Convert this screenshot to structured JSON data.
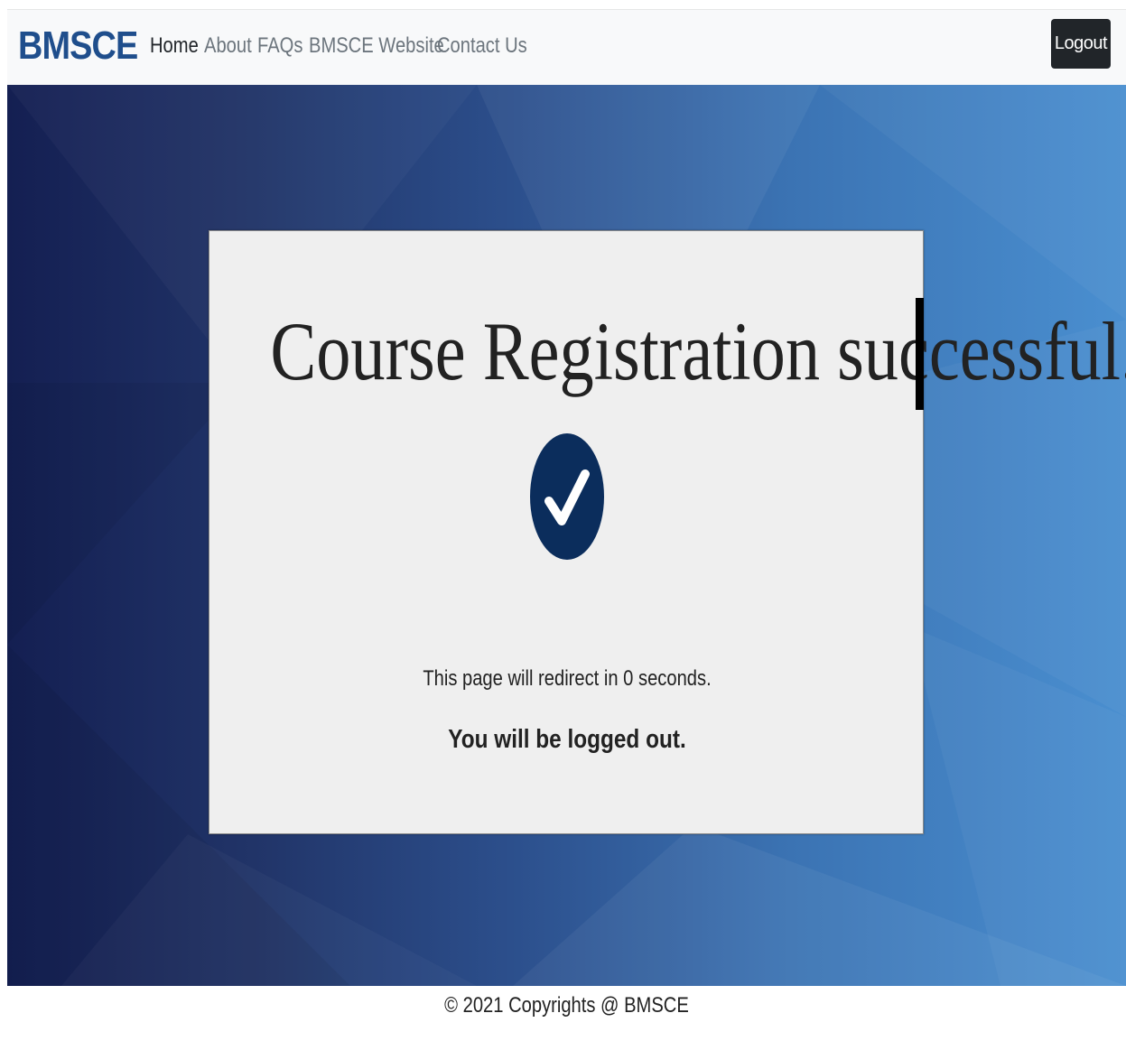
{
  "navbar": {
    "brand": "BMSCE",
    "links": [
      {
        "label": "Home",
        "active": true
      },
      {
        "label": "About",
        "active": false
      },
      {
        "label": "FAQs",
        "active": false
      },
      {
        "label": "BMSCE Website",
        "active": false
      },
      {
        "label": "Contact Us",
        "active": false
      }
    ],
    "logout_label": "Logout"
  },
  "card": {
    "title": "Course Registration successful.",
    "icon": "check-circle-icon",
    "redirect_message": "This page will redirect in 0 seconds.",
    "logout_message": "You will be logged out."
  },
  "footer": {
    "text": "© 2021 Copyrights @ BMSCE"
  },
  "colors": {
    "brand": "#1f4e8c",
    "check_circle": "#0b2d5c",
    "logout_button": "#212529",
    "hero_gradient_start": "#141f52",
    "hero_gradient_end": "#4a8fd0"
  }
}
